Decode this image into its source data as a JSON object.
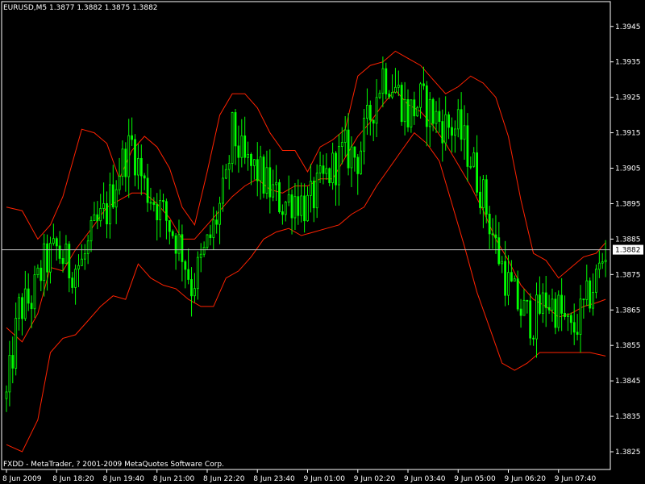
{
  "header": {
    "title": "EURUSD,M5  1.3877 1.3882 1.3875 1.3882"
  },
  "footer": {
    "copyright": "FXDD - MetaTrader, ? 2001-2009 MetaQuotes Software Corp."
  },
  "colors": {
    "background": "#000000",
    "frame": "#ffffff",
    "candle_up": "#00ff00",
    "candle_down": "#00ff00",
    "bands": "#ff2200",
    "price_line": "#c0c0c0",
    "price_label_bg": "#ffffff",
    "price_label_text": "#000000"
  },
  "chart_data": {
    "type": "candlestick",
    "symbol": "EURUSD",
    "timeframe": "M5",
    "ylim": [
      1.382,
      1.3952
    ],
    "y_ticks": [
      "1.3945",
      "1.3935",
      "1.3925",
      "1.3915",
      "1.3905",
      "1.3895",
      "1.3885",
      "1.3875",
      "1.3865",
      "1.3855",
      "1.3845",
      "1.3835",
      "1.3825"
    ],
    "x_ticks": [
      "8 Jun 2009",
      "8 Jun 18:20",
      "8 Jun 19:40",
      "8 Jun 21:00",
      "8 Jun 22:20",
      "8 Jun 23:40",
      "9 Jun 01:00",
      "9 Jun 02:20",
      "9 Jun 03:40",
      "9 Jun 05:00",
      "9 Jun 06:20",
      "9 Jun 07:40"
    ],
    "current_price": "1.3882",
    "close_anchors": [
      [
        0,
        1.384
      ],
      [
        4,
        1.3865
      ],
      [
        8,
        1.3868
      ],
      [
        12,
        1.3878
      ],
      [
        16,
        1.3882
      ],
      [
        20,
        1.3877
      ],
      [
        24,
        1.3878
      ],
      [
        28,
        1.3887
      ],
      [
        32,
        1.3893
      ],
      [
        36,
        1.3905
      ],
      [
        40,
        1.3912
      ],
      [
        44,
        1.39
      ],
      [
        48,
        1.3895
      ],
      [
        52,
        1.3889
      ],
      [
        56,
        1.3882
      ],
      [
        59,
        1.3872
      ],
      [
        62,
        1.3878
      ],
      [
        66,
        1.3888
      ],
      [
        70,
        1.39
      ],
      [
        72,
        1.3915
      ],
      [
        76,
        1.3906
      ],
      [
        80,
        1.3904
      ],
      [
        84,
        1.3899
      ],
      [
        88,
        1.3895
      ],
      [
        92,
        1.3897
      ],
      [
        96,
        1.3894
      ],
      [
        100,
        1.39
      ],
      [
        104,
        1.3905
      ],
      [
        108,
        1.391
      ],
      [
        112,
        1.3908
      ],
      [
        116,
        1.392
      ],
      [
        120,
        1.3932
      ],
      [
        124,
        1.3928
      ],
      [
        128,
        1.392
      ],
      [
        132,
        1.3924
      ],
      [
        136,
        1.392
      ],
      [
        140,
        1.3917
      ],
      [
        144,
        1.3916
      ],
      [
        148,
        1.3908
      ],
      [
        152,
        1.3897
      ],
      [
        156,
        1.3883
      ],
      [
        160,
        1.3872
      ],
      [
        164,
        1.3865
      ],
      [
        168,
        1.3862
      ],
      [
        172,
        1.3868
      ],
      [
        176,
        1.3865
      ],
      [
        180,
        1.3858
      ],
      [
        184,
        1.3865
      ],
      [
        188,
        1.3874
      ],
      [
        191,
        1.3882
      ]
    ],
    "bands": {
      "upper": [
        [
          0,
          1.3894
        ],
        [
          5,
          1.3893
        ],
        [
          10,
          1.3885
        ],
        [
          14,
          1.3889
        ],
        [
          18,
          1.3897
        ],
        [
          24,
          1.3916
        ],
        [
          28,
          1.3915
        ],
        [
          32,
          1.3912
        ],
        [
          36,
          1.3902
        ],
        [
          40,
          1.391
        ],
        [
          44,
          1.3914
        ],
        [
          48,
          1.3911
        ],
        [
          52,
          1.3905
        ],
        [
          56,
          1.3894
        ],
        [
          60,
          1.3889
        ],
        [
          64,
          1.3904
        ],
        [
          68,
          1.392
        ],
        [
          72,
          1.3926
        ],
        [
          76,
          1.3926
        ],
        [
          80,
          1.3922
        ],
        [
          84,
          1.3915
        ],
        [
          88,
          1.391
        ],
        [
          92,
          1.391
        ],
        [
          96,
          1.3904
        ],
        [
          100,
          1.3911
        ],
        [
          104,
          1.3913
        ],
        [
          108,
          1.3916
        ],
        [
          112,
          1.3931
        ],
        [
          116,
          1.3934
        ],
        [
          120,
          1.3935
        ],
        [
          124,
          1.3938
        ],
        [
          128,
          1.3936
        ],
        [
          132,
          1.3934
        ],
        [
          136,
          1.393
        ],
        [
          140,
          1.3926
        ],
        [
          144,
          1.3928
        ],
        [
          148,
          1.3931
        ],
        [
          152,
          1.3929
        ],
        [
          156,
          1.3925
        ],
        [
          160,
          1.3914
        ],
        [
          164,
          1.3896
        ],
        [
          168,
          1.3881
        ],
        [
          172,
          1.3879
        ],
        [
          176,
          1.3874
        ],
        [
          180,
          1.3877
        ],
        [
          184,
          1.388
        ],
        [
          188,
          1.3881
        ],
        [
          191,
          1.3884
        ]
      ],
      "middle": [
        [
          0,
          1.386
        ],
        [
          5,
          1.3856
        ],
        [
          10,
          1.3864
        ],
        [
          14,
          1.3877
        ],
        [
          18,
          1.3876
        ],
        [
          22,
          1.3882
        ],
        [
          28,
          1.3889
        ],
        [
          32,
          1.3894
        ],
        [
          36,
          1.3896
        ],
        [
          40,
          1.3898
        ],
        [
          44,
          1.3898
        ],
        [
          48,
          1.3895
        ],
        [
          52,
          1.3891
        ],
        [
          56,
          1.3885
        ],
        [
          60,
          1.3885
        ],
        [
          64,
          1.3889
        ],
        [
          68,
          1.3893
        ],
        [
          72,
          1.3897
        ],
        [
          76,
          1.39
        ],
        [
          80,
          1.3902
        ],
        [
          84,
          1.3899
        ],
        [
          88,
          1.3898
        ],
        [
          92,
          1.39
        ],
        [
          96,
          1.39
        ],
        [
          100,
          1.3902
        ],
        [
          104,
          1.3902
        ],
        [
          108,
          1.3908
        ],
        [
          112,
          1.3914
        ],
        [
          116,
          1.3918
        ],
        [
          120,
          1.3923
        ],
        [
          124,
          1.3927
        ],
        [
          128,
          1.3923
        ],
        [
          132,
          1.3921
        ],
        [
          136,
          1.3917
        ],
        [
          140,
          1.3912
        ],
        [
          144,
          1.3906
        ],
        [
          148,
          1.39
        ],
        [
          152,
          1.3893
        ],
        [
          156,
          1.3885
        ],
        [
          160,
          1.3879
        ],
        [
          164,
          1.3872
        ],
        [
          168,
          1.3868
        ],
        [
          172,
          1.3866
        ],
        [
          176,
          1.3863
        ],
        [
          180,
          1.3864
        ],
        [
          184,
          1.3866
        ],
        [
          188,
          1.3867
        ],
        [
          191,
          1.3868
        ]
      ],
      "lower": [
        [
          0,
          1.3827
        ],
        [
          5,
          1.3825
        ],
        [
          10,
          1.3834
        ],
        [
          14,
          1.3853
        ],
        [
          18,
          1.3857
        ],
        [
          22,
          1.3858
        ],
        [
          26,
          1.3862
        ],
        [
          30,
          1.3866
        ],
        [
          34,
          1.3869
        ],
        [
          38,
          1.3868
        ],
        [
          42,
          1.3878
        ],
        [
          46,
          1.3874
        ],
        [
          50,
          1.3872
        ],
        [
          54,
          1.3871
        ],
        [
          58,
          1.3868
        ],
        [
          62,
          1.3866
        ],
        [
          66,
          1.3866
        ],
        [
          70,
          1.3874
        ],
        [
          74,
          1.3876
        ],
        [
          78,
          1.388
        ],
        [
          82,
          1.3885
        ],
        [
          86,
          1.3887
        ],
        [
          90,
          1.3888
        ],
        [
          94,
          1.3886
        ],
        [
          98,
          1.3887
        ],
        [
          102,
          1.3888
        ],
        [
          106,
          1.3889
        ],
        [
          110,
          1.3892
        ],
        [
          114,
          1.3894
        ],
        [
          118,
          1.39
        ],
        [
          122,
          1.3905
        ],
        [
          126,
          1.391
        ],
        [
          130,
          1.3915
        ],
        [
          134,
          1.3912
        ],
        [
          138,
          1.3907
        ],
        [
          142,
          1.3895
        ],
        [
          146,
          1.3883
        ],
        [
          150,
          1.387
        ],
        [
          154,
          1.386
        ],
        [
          158,
          1.385
        ],
        [
          162,
          1.3848
        ],
        [
          166,
          1.385
        ],
        [
          170,
          1.3853
        ],
        [
          174,
          1.3853
        ],
        [
          178,
          1.3853
        ],
        [
          182,
          1.3853
        ],
        [
          186,
          1.3853
        ],
        [
          191,
          1.3852
        ]
      ]
    }
  }
}
